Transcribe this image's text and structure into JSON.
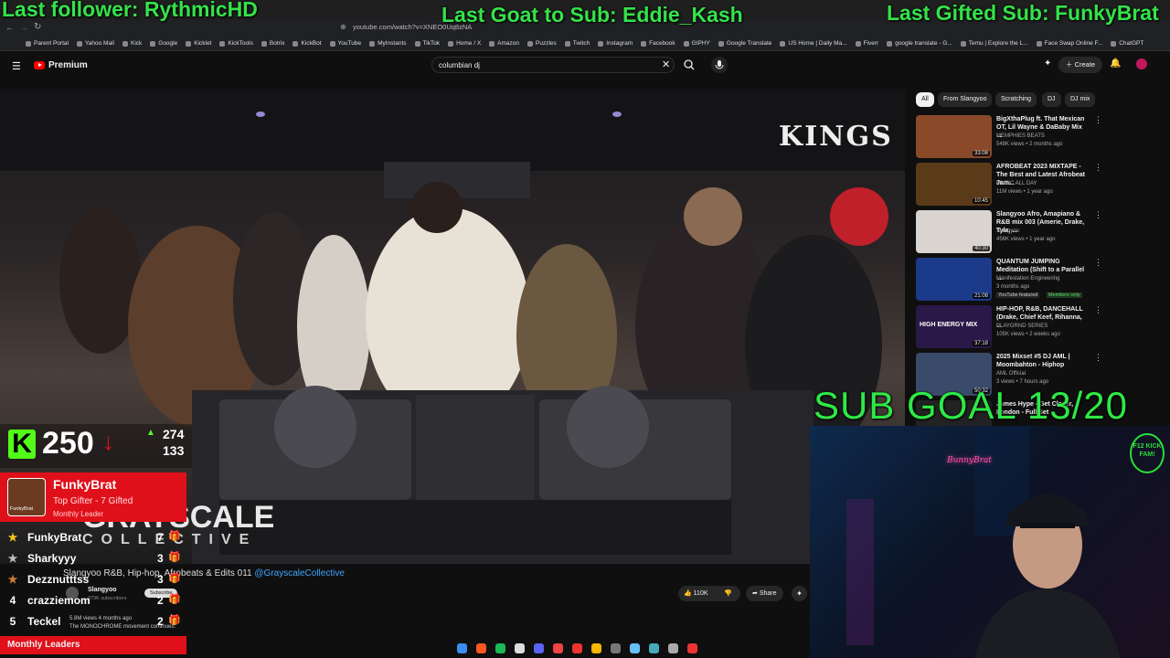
{
  "overlay": {
    "last_follower": "Last follower: RythmicHD",
    "last_goat": "Last Goat to Sub: Eddie_Kash",
    "last_gifted": "Last Gifted Sub: FunkyBrat",
    "sub_goal": "SUB GOAL 13/20"
  },
  "browser": {
    "url": "youtube.com/watch?v=XNEO0Uq8zNA",
    "bookmarks": [
      "Parent Portal",
      "Yahoo Mail",
      "Kick",
      "Google",
      "Kicklet",
      "KickTools",
      "Botrix",
      "KickBot",
      "YouTube",
      "MyInstants",
      "TikTok",
      "Home / X",
      "Amazon",
      "Puzzles",
      "Twitch",
      "Instagram",
      "Facebook",
      "GIPHY",
      "Google Translate",
      "US Home | Daily Ma...",
      "Fiverr",
      "google translate - G...",
      "Temu | Explore the L...",
      "Face Swap Online F...",
      "ChatGPT"
    ]
  },
  "youtube": {
    "logo_label": "Premium",
    "search_value": "columbian dj",
    "create_label": "Create",
    "video_title": "Slangyoo R&B, Hip-hop, Afrobeats & Edits 011",
    "video_handle": "@GrayscaleCollective",
    "channel": "Slangyoo",
    "subscribers": "379K subscribers",
    "subscribe_label": "Subscribe",
    "views_date": "5.8M views  4 months ago",
    "description": "The MONOCHROME movement continues.",
    "likes": "110K",
    "share_label": "Share",
    "video_sign": "KINGS",
    "video_watermark": "GRAYSCALE",
    "video_watermark2": "COLLECTIVE",
    "chips": [
      "All",
      "From Slangyoo",
      "Scratching",
      "DJ",
      "DJ mix"
    ],
    "recommendations": [
      {
        "title": "BigXthaPlug ft. That Mexican OT, Lil Wayne & DaBaby Mix ...",
        "channel": "MEMPHIES BEATS",
        "meta": "548K views • 2 months ago",
        "duration": "33:08",
        "color": "#8a4a2a"
      },
      {
        "title": "AFROBEAT 2023 MIXTAPE - The Best and Latest Afrobeat Jam...",
        "channel": "MUSIC ALL DAY",
        "meta": "11M views • 1 year ago",
        "duration": "10:45",
        "color": "#5a3a18"
      },
      {
        "title": "Slangyoo Afro, Amapiano & R&B mix 003 (Amerie, Drake, Tyla, ...",
        "channel": "Slangyoo",
        "meta": "456K views • 1 year ago",
        "duration": "40:30",
        "color": "#d9d4cf"
      },
      {
        "title": "QUANTUM JUMPING Meditation (Shift to a Parallel ...",
        "channel": "Manifestation Engineering",
        "meta": "3 months ago",
        "duration": "21:08",
        "color": "#1c3a8a",
        "badge1": "YouTube featured",
        "badge2": "Members only"
      },
      {
        "title": "HIP-HOP, R&B, DANCEHALL (Drake, Chief Keef, Rihanna, ...",
        "channel": "PLAYGRND SERIES",
        "meta": "105K views • 2 weeks ago",
        "duration": "37:18",
        "color": "#2a1848",
        "thumb_text": "HIGH ENERGY MIX"
      },
      {
        "title": "2025 Mixset #5 DJ AML | Moombahton - Hiphop",
        "channel": "AML Official",
        "meta": "3 views • 7 hours ago",
        "duration": "50:32",
        "color": "#3a4a6a"
      },
      {
        "title": "James Hype - Get Closer, London - Full Set",
        "channel": "",
        "meta": "",
        "duration": "",
        "color": "#222"
      }
    ]
  },
  "kick": {
    "count": "250",
    "up": "274",
    "down": "133"
  },
  "gifter": {
    "name": "FunkyBrat",
    "subtitle": "Top Gifter - 7 Gifted",
    "label": "Monthly Leader",
    "avatar_name": "FunkyBrat"
  },
  "leaders": {
    "rows": [
      {
        "rank": "",
        "name": "FunkyBrat",
        "count": "7"
      },
      {
        "rank": "",
        "name": "Sharkyyy",
        "count": "3"
      },
      {
        "rank": "",
        "name": "Dezznutttss",
        "count": "3"
      },
      {
        "rank": "4",
        "name": "crazziemom",
        "count": "2"
      },
      {
        "rank": "5",
        "name": "Teckel",
        "count": "2"
      }
    ],
    "footer": "Monthly Leaders"
  },
  "webcam": {
    "sign": "F12 KICK FAM!",
    "neon": "BunnyBrat"
  },
  "colors": {
    "overlay_green": "#34e34a",
    "gifter_red": "#e0101a",
    "youtube_red": "#ff0000"
  }
}
